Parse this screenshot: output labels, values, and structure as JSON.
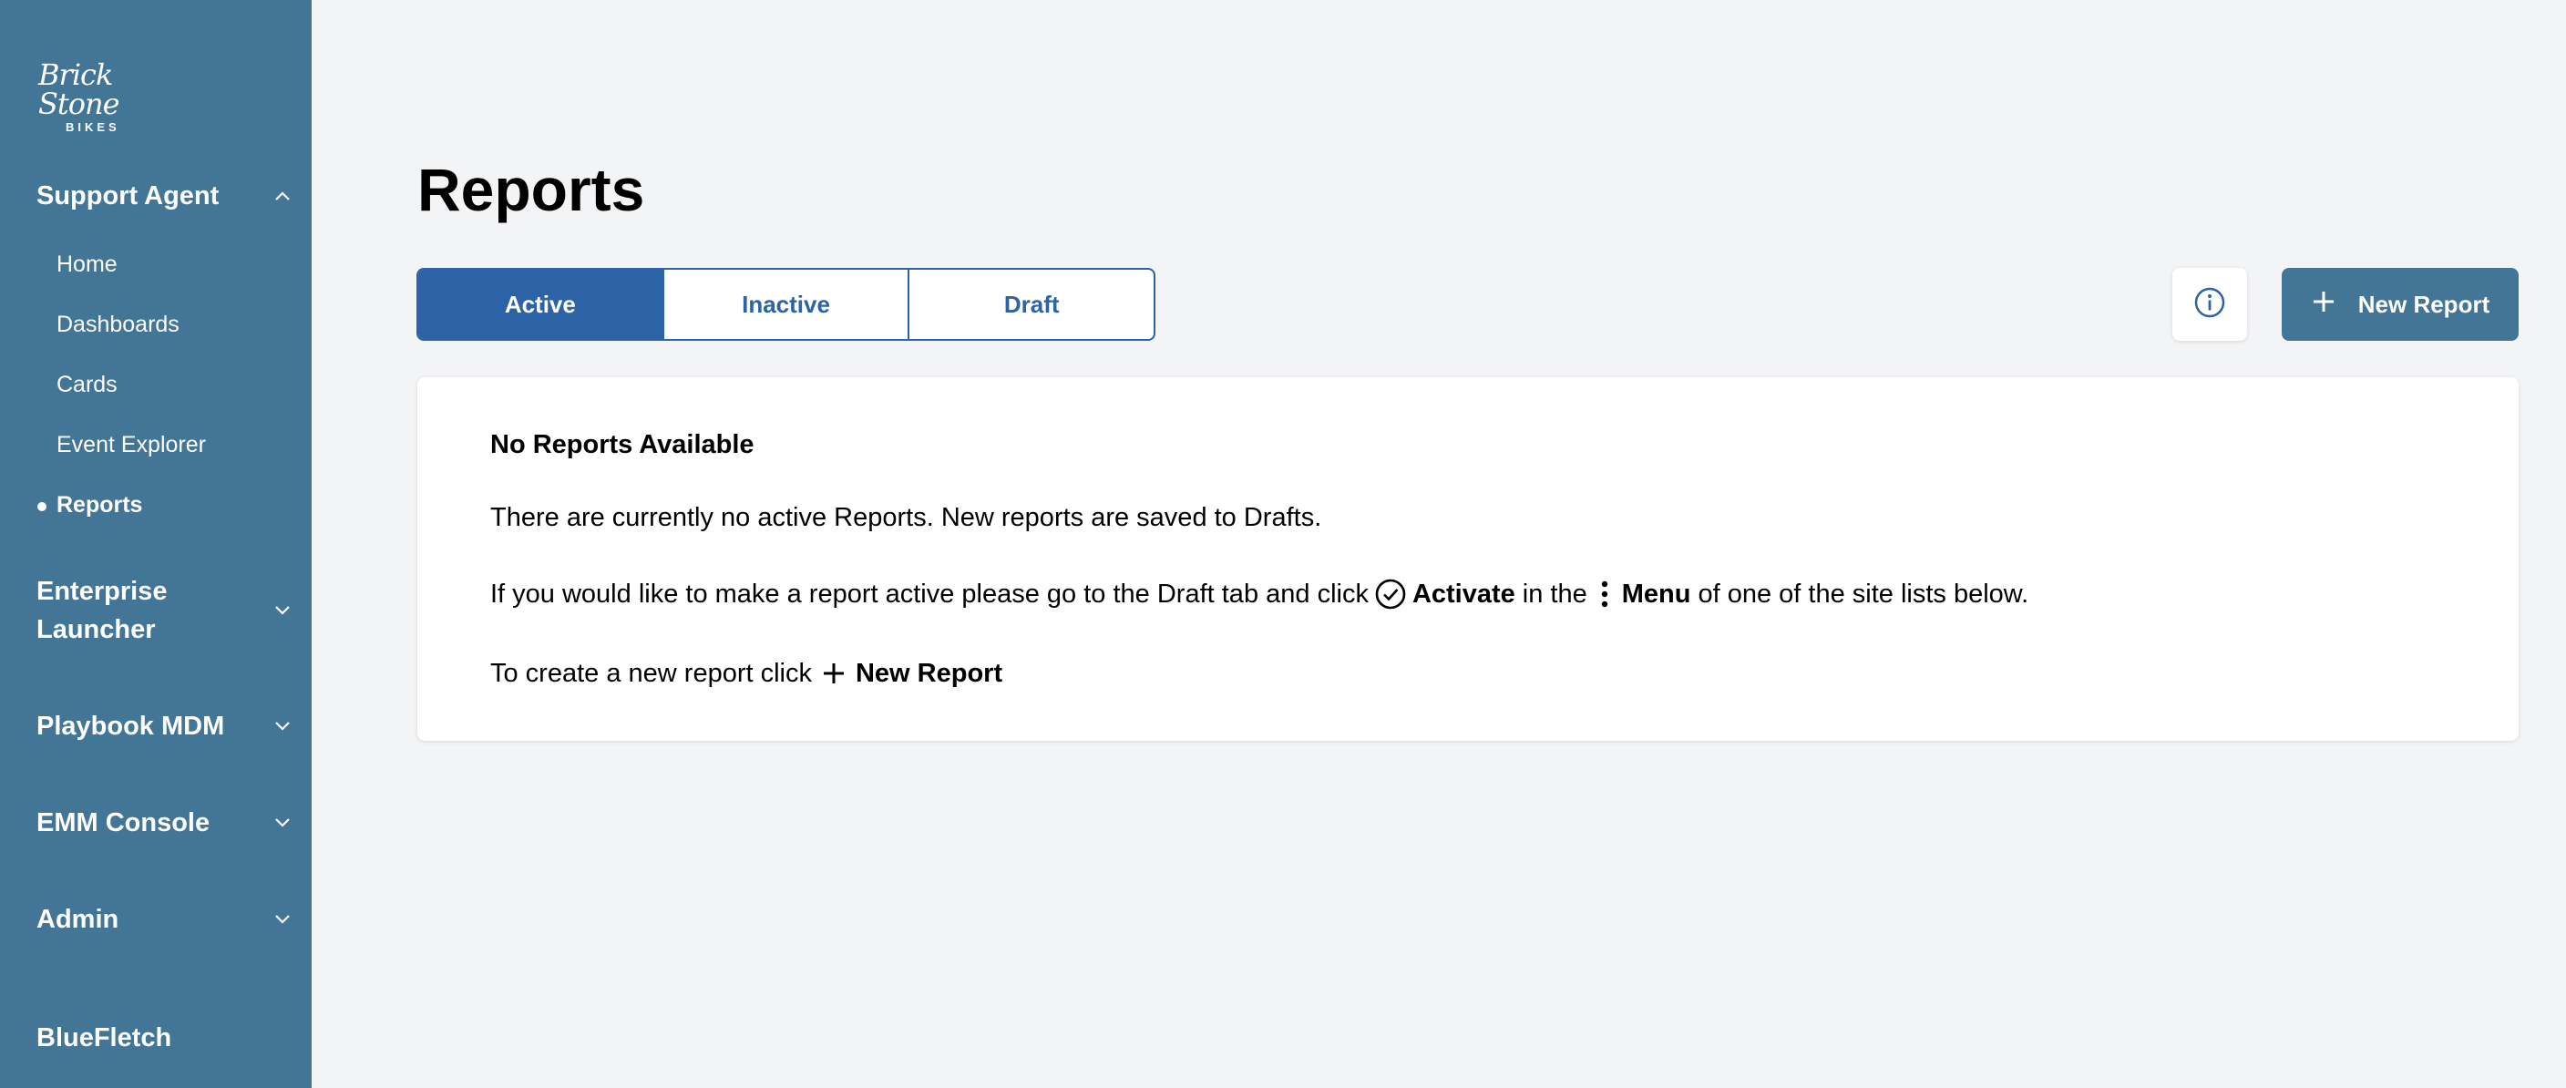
{
  "brand": {
    "script": "Brick Stone",
    "sub": "BIKES"
  },
  "sidebar": {
    "sections": [
      {
        "label": "Support Agent",
        "expanded": true,
        "items": [
          {
            "label": "Home"
          },
          {
            "label": "Dashboards"
          },
          {
            "label": "Cards"
          },
          {
            "label": "Event Explorer"
          },
          {
            "label": "Reports",
            "active": true
          }
        ]
      },
      {
        "label_line1": "Enterprise",
        "label_line2": "Launcher",
        "expanded": false
      },
      {
        "label": "Playbook MDM",
        "expanded": false
      },
      {
        "label": "EMM Console",
        "expanded": false
      },
      {
        "label": "Admin",
        "expanded": false
      }
    ],
    "footer": "BlueFletch"
  },
  "main": {
    "title": "Reports",
    "tabs": [
      {
        "label": "Active",
        "selected": true
      },
      {
        "label": "Inactive",
        "selected": false
      },
      {
        "label": "Draft",
        "selected": false
      }
    ],
    "new_report_label": "New Report",
    "empty_state": {
      "title": "No Reports Available",
      "line1": "There are currently no active Reports. New reports are saved to Drafts.",
      "line2_a": "If you would like to make a report active please go to the Draft tab and click",
      "line2_activate": "Activate",
      "line2_b": "in the",
      "line2_menu": "Menu",
      "line2_c": "of one of the site lists below.",
      "line3_a": "To create a new report click",
      "line3_new": "New Report"
    }
  },
  "colors": {
    "sidebar": "#437696",
    "primary": "#2b63a6",
    "background": "#f3f4f6"
  },
  "icons": [
    "chevron-up-icon",
    "chevron-down-icon",
    "info-icon",
    "plus-icon",
    "check-circle-icon",
    "kebab-menu-icon"
  ]
}
